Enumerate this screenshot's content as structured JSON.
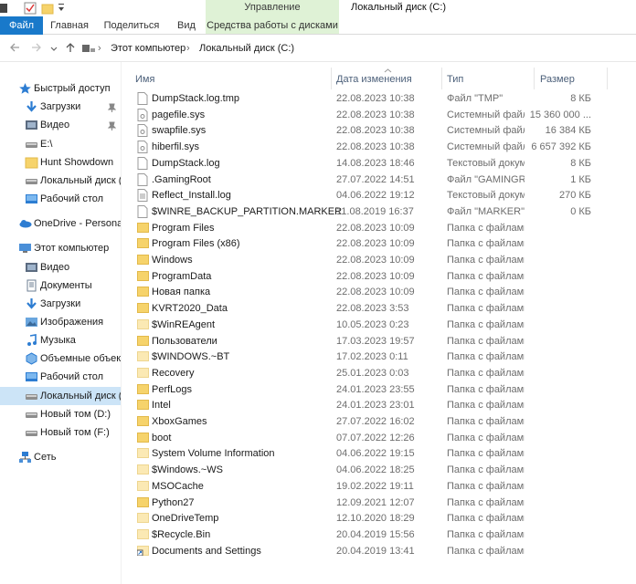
{
  "ribbon": {
    "context_group": "Управление",
    "window_title": "Локальный диск (C:)",
    "tabs": [
      "Файл",
      "Главная",
      "Поделиться",
      "Вид",
      "Средства работы с дисками"
    ]
  },
  "address": {
    "crumbs": [
      "Этот компьютер",
      "Локальный диск (C:)"
    ]
  },
  "sidebar": {
    "items": [
      {
        "label": "Быстрый доступ",
        "icon": "star-icon",
        "level": 0
      },
      {
        "label": "Загрузки",
        "icon": "download-icon",
        "level": 1,
        "pinned": true
      },
      {
        "label": "Видео",
        "icon": "video-icon",
        "level": 1,
        "pinned": true
      },
      {
        "label": "E:\\",
        "icon": "drive-icon",
        "level": 1
      },
      {
        "label": "Hunt  Showdown",
        "icon": "folder-icon",
        "level": 1
      },
      {
        "label": "Локальный диск (C",
        "icon": "drive-icon",
        "level": 1
      },
      {
        "label": "Рабочий стол",
        "icon": "desktop-icon",
        "level": 1
      },
      {
        "label": "OneDrive - Personal",
        "icon": "cloud-icon",
        "level": 0
      },
      {
        "label": "Этот компьютер",
        "icon": "computer-icon",
        "level": 0
      },
      {
        "label": "Видео",
        "icon": "video-icon",
        "level": 1
      },
      {
        "label": "Документы",
        "icon": "documents-icon",
        "level": 1
      },
      {
        "label": "Загрузки",
        "icon": "download-icon",
        "level": 1
      },
      {
        "label": "Изображения",
        "icon": "pictures-icon",
        "level": 1
      },
      {
        "label": "Музыка",
        "icon": "music-icon",
        "level": 1
      },
      {
        "label": "Объемные объекты",
        "icon": "3d-objects-icon",
        "level": 1
      },
      {
        "label": "Рабочий стол",
        "icon": "desktop-icon",
        "level": 1
      },
      {
        "label": "Локальный диск (C",
        "icon": "drive-icon",
        "level": 1,
        "selected": true
      },
      {
        "label": "Новый том (D:)",
        "icon": "drive-icon",
        "level": 1
      },
      {
        "label": "Новый том (F:)",
        "icon": "drive-icon",
        "level": 1
      },
      {
        "label": "Сеть",
        "icon": "network-icon",
        "level": 0
      }
    ]
  },
  "columns": [
    "Имя",
    "Дата изменения",
    "Тип",
    "Размер"
  ],
  "files": [
    {
      "name": "DumpStack.log.tmp",
      "date": "22.08.2023 10:38",
      "type": "Файл \"TMP\"",
      "size": "8 КБ",
      "kind": "file"
    },
    {
      "name": "pagefile.sys",
      "date": "22.08.2023 10:38",
      "type": "Системный файл",
      "size": "15 360 000 ...",
      "kind": "sys"
    },
    {
      "name": "swapfile.sys",
      "date": "22.08.2023 10:38",
      "type": "Системный файл",
      "size": "16 384 КБ",
      "kind": "sys"
    },
    {
      "name": "hiberfil.sys",
      "date": "22.08.2023 10:38",
      "type": "Системный файл",
      "size": "6 657 392 КБ",
      "kind": "sys"
    },
    {
      "name": "DumpStack.log",
      "date": "14.08.2023 18:46",
      "type": "Текстовый докум...",
      "size": "8 КБ",
      "kind": "file"
    },
    {
      "name": ".GamingRoot",
      "date": "27.07.2022 14:51",
      "type": "Файл \"GAMINGR...",
      "size": "1 КБ",
      "kind": "file"
    },
    {
      "name": "Reflect_Install.log",
      "date": "04.06.2022 19:12",
      "type": "Текстовый докум...",
      "size": "270 КБ",
      "kind": "text"
    },
    {
      "name": "$WINRE_BACKUP_PARTITION.MARKER",
      "date": "11.08.2019 16:37",
      "type": "Файл \"MARKER\"",
      "size": "0 КБ",
      "kind": "file"
    },
    {
      "name": "Program Files",
      "date": "22.08.2023 10:09",
      "type": "Папка с файлами",
      "size": "",
      "kind": "folder"
    },
    {
      "name": "Program Files (x86)",
      "date": "22.08.2023 10:09",
      "type": "Папка с файлами",
      "size": "",
      "kind": "folder"
    },
    {
      "name": "Windows",
      "date": "22.08.2023 10:09",
      "type": "Папка с файлами",
      "size": "",
      "kind": "folder"
    },
    {
      "name": "ProgramData",
      "date": "22.08.2023 10:09",
      "type": "Папка с файлами",
      "size": "",
      "kind": "folder"
    },
    {
      "name": "Новая папка",
      "date": "22.08.2023 10:09",
      "type": "Папка с файлами",
      "size": "",
      "kind": "folder"
    },
    {
      "name": "KVRT2020_Data",
      "date": "22.08.2023 3:53",
      "type": "Папка с файлами",
      "size": "",
      "kind": "folder"
    },
    {
      "name": "$WinREAgent",
      "date": "10.05.2023 0:23",
      "type": "Папка с файлами",
      "size": "",
      "kind": "folder-faded"
    },
    {
      "name": "Пользователи",
      "date": "17.03.2023 19:57",
      "type": "Папка с файлами",
      "size": "",
      "kind": "folder"
    },
    {
      "name": "$WINDOWS.~BT",
      "date": "17.02.2023 0:11",
      "type": "Папка с файлами",
      "size": "",
      "kind": "folder-faded"
    },
    {
      "name": "Recovery",
      "date": "25.01.2023 0:03",
      "type": "Папка с файлами",
      "size": "",
      "kind": "folder-faded"
    },
    {
      "name": "PerfLogs",
      "date": "24.01.2023 23:55",
      "type": "Папка с файлами",
      "size": "",
      "kind": "folder"
    },
    {
      "name": "Intel",
      "date": "24.01.2023 23:01",
      "type": "Папка с файлами",
      "size": "",
      "kind": "folder"
    },
    {
      "name": "XboxGames",
      "date": "27.07.2022 16:02",
      "type": "Папка с файлами",
      "size": "",
      "kind": "folder"
    },
    {
      "name": "boot",
      "date": "07.07.2022 12:26",
      "type": "Папка с файлами",
      "size": "",
      "kind": "folder"
    },
    {
      "name": "System Volume Information",
      "date": "04.06.2022 19:15",
      "type": "Папка с файлами",
      "size": "",
      "kind": "folder-faded"
    },
    {
      "name": "$Windows.~WS",
      "date": "04.06.2022 18:25",
      "type": "Папка с файлами",
      "size": "",
      "kind": "folder-faded"
    },
    {
      "name": "MSOCache",
      "date": "19.02.2022 19:11",
      "type": "Папка с файлами",
      "size": "",
      "kind": "folder-faded"
    },
    {
      "name": "Python27",
      "date": "12.09.2021 12:07",
      "type": "Папка с файлами",
      "size": "",
      "kind": "folder"
    },
    {
      "name": "OneDriveTemp",
      "date": "12.10.2020 18:29",
      "type": "Папка с файлами",
      "size": "",
      "kind": "folder-faded"
    },
    {
      "name": "$Recycle.Bin",
      "date": "20.04.2019 15:56",
      "type": "Папка с файлами",
      "size": "",
      "kind": "folder-faded"
    },
    {
      "name": "Documents and Settings",
      "date": "20.04.2019 13:41",
      "type": "Папка с файлами",
      "size": "",
      "kind": "shortcut-folder"
    }
  ],
  "colors": {
    "accent": "#1979ca",
    "folder": "#f6d36b",
    "selected": "#cce4f7",
    "context": "#dff2d6"
  }
}
